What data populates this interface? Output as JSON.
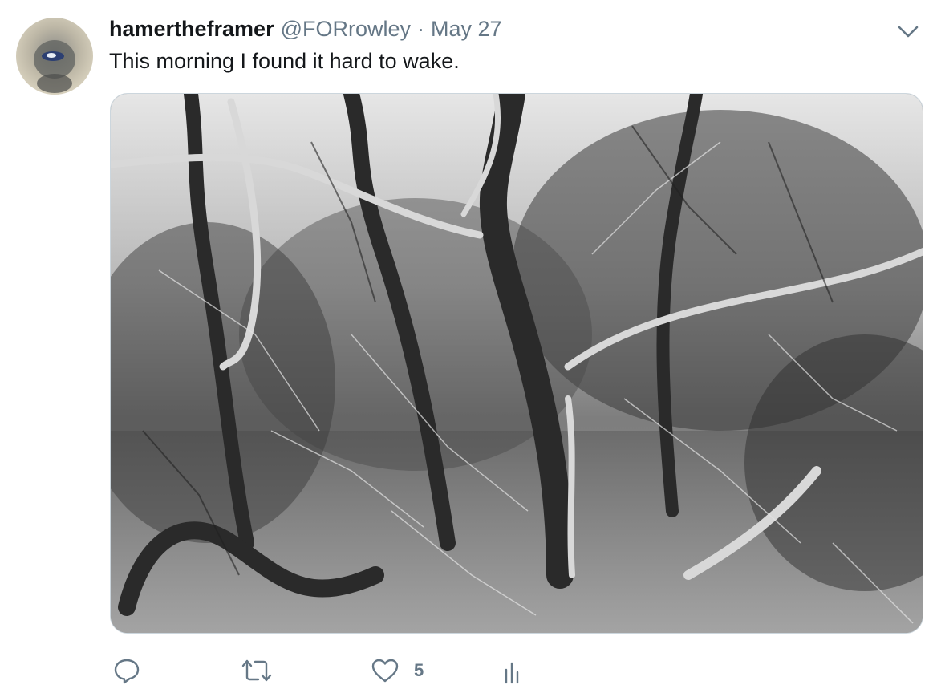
{
  "tweet": {
    "display_name": "hamertheframer",
    "handle": "@FORrowley",
    "separator": "·",
    "date": "May 27",
    "text": "This morning I found it hard to wake.",
    "like_count": "5"
  },
  "icons": {
    "caret": "chevron-down-icon",
    "reply": "reply-icon",
    "retweet": "retweet-icon",
    "like": "heart-icon",
    "analytics": "analytics-icon"
  },
  "colors": {
    "text": "#14171a",
    "muted": "#657786",
    "border": "#ccd6dd"
  }
}
